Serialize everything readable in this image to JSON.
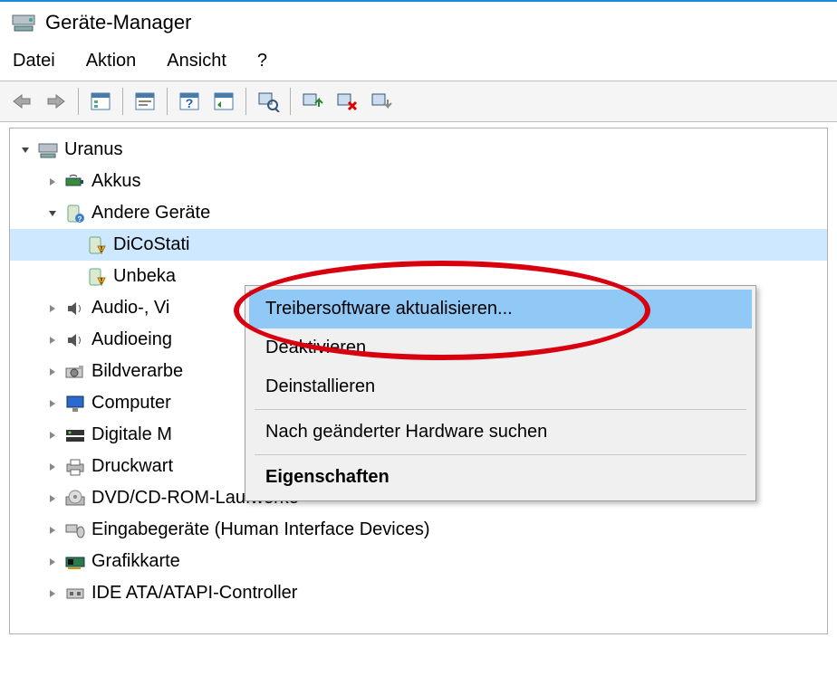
{
  "window": {
    "title": "Geräte-Manager"
  },
  "menu": {
    "file": "Datei",
    "action": "Aktion",
    "view": "Ansicht",
    "help": "?"
  },
  "tree": {
    "root": "Uranus",
    "items": [
      {
        "label": "Akkus"
      },
      {
        "label": "Andere Geräte",
        "expanded": true
      },
      {
        "label": "DiCoStati"
      },
      {
        "label": "Unbeka"
      },
      {
        "label": "Audio-, Vi"
      },
      {
        "label": "Audioeing"
      },
      {
        "label": "Bildverarbe"
      },
      {
        "label": "Computer"
      },
      {
        "label": "Digitale M"
      },
      {
        "label": "Druckwart"
      },
      {
        "label": "DVD/CD-ROM-Laufwerke"
      },
      {
        "label": "Eingabegeräte (Human Interface Devices)"
      },
      {
        "label": "Grafikkarte"
      },
      {
        "label": "IDE ATA/ATAPI-Controller"
      }
    ]
  },
  "context": {
    "update": "Treibersoftware aktualisieren...",
    "deactivate": "Deaktivieren",
    "uninstall": "Deinstallieren",
    "scan": "Nach geänderter Hardware suchen",
    "properties": "Eigenschaften"
  }
}
